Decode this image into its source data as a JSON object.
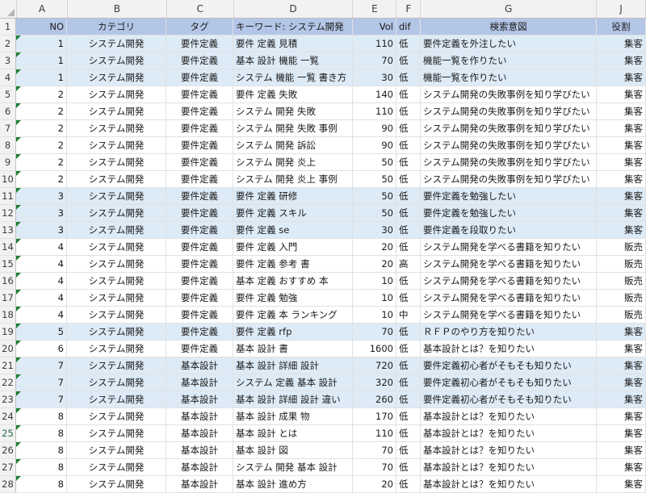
{
  "columns": [
    "A",
    "B",
    "C",
    "D",
    "E",
    "F",
    "G",
    "J"
  ],
  "header": {
    "no": "NO",
    "category": "カテゴリ",
    "tag": "タグ",
    "keyword": "キーワード: システム開発",
    "vol": "Vol",
    "dif": "dif",
    "intent": "検索意図",
    "role": "役割"
  },
  "rows": [
    {
      "rn": "2",
      "no": "1",
      "cat": "システム開発",
      "tag": "要件定義",
      "kw": "要件 定義 見積",
      "vol": "110",
      "dif": "低",
      "intent": "要件定義を外注したい",
      "role": "集客",
      "hl": true
    },
    {
      "rn": "3",
      "no": "1",
      "cat": "システム開発",
      "tag": "要件定義",
      "kw": "基本 設計 機能 一覧",
      "vol": "70",
      "dif": "低",
      "intent": "機能一覧を作りたい",
      "role": "集客",
      "hl": true
    },
    {
      "rn": "4",
      "no": "1",
      "cat": "システム開発",
      "tag": "要件定義",
      "kw": "システム 機能 一覧 書き方",
      "vol": "30",
      "dif": "低",
      "intent": "機能一覧を作りたい",
      "role": "集客",
      "hl": true
    },
    {
      "rn": "5",
      "no": "2",
      "cat": "システム開発",
      "tag": "要件定義",
      "kw": "要件 定義 失敗",
      "vol": "140",
      "dif": "低",
      "intent": "システム開発の失敗事例を知り学びたい",
      "role": "集客",
      "hl": false
    },
    {
      "rn": "6",
      "no": "2",
      "cat": "システム開発",
      "tag": "要件定義",
      "kw": "システム 開発 失敗",
      "vol": "110",
      "dif": "低",
      "intent": "システム開発の失敗事例を知り学びたい",
      "role": "集客",
      "hl": false
    },
    {
      "rn": "7",
      "no": "2",
      "cat": "システム開発",
      "tag": "要件定義",
      "kw": "システム 開発 失敗 事例",
      "vol": "90",
      "dif": "低",
      "intent": "システム開発の失敗事例を知り学びたい",
      "role": "集客",
      "hl": false
    },
    {
      "rn": "8",
      "no": "2",
      "cat": "システム開発",
      "tag": "要件定義",
      "kw": "システム 開発 訴訟",
      "vol": "90",
      "dif": "低",
      "intent": "システム開発の失敗事例を知り学びたい",
      "role": "集客",
      "hl": false
    },
    {
      "rn": "9",
      "no": "2",
      "cat": "システム開発",
      "tag": "要件定義",
      "kw": "システム 開発 炎上",
      "vol": "50",
      "dif": "低",
      "intent": "システム開発の失敗事例を知り学びたい",
      "role": "集客",
      "hl": false
    },
    {
      "rn": "10",
      "no": "2",
      "cat": "システム開発",
      "tag": "要件定義",
      "kw": "システム 開発 炎上 事例",
      "vol": "50",
      "dif": "低",
      "intent": "システム開発の失敗事例を知り学びたい",
      "role": "集客",
      "hl": false
    },
    {
      "rn": "11",
      "no": "3",
      "cat": "システム開発",
      "tag": "要件定義",
      "kw": "要件 定義 研修",
      "vol": "50",
      "dif": "低",
      "intent": "要件定義を勉強したい",
      "role": "集客",
      "hl": true
    },
    {
      "rn": "12",
      "no": "3",
      "cat": "システム開発",
      "tag": "要件定義",
      "kw": "要件 定義 スキル",
      "vol": "50",
      "dif": "低",
      "intent": "要件定義を勉強したい",
      "role": "集客",
      "hl": true
    },
    {
      "rn": "13",
      "no": "3",
      "cat": "システム開発",
      "tag": "要件定義",
      "kw": "要件 定義 se",
      "vol": "30",
      "dif": "低",
      "intent": "要件定義を段取りたい",
      "role": "集客",
      "hl": true
    },
    {
      "rn": "14",
      "no": "4",
      "cat": "システム開発",
      "tag": "要件定義",
      "kw": "要件 定義 入門",
      "vol": "20",
      "dif": "低",
      "intent": "システム開発を学べる書籍を知りたい",
      "role": "販売",
      "hl": false
    },
    {
      "rn": "15",
      "no": "4",
      "cat": "システム開発",
      "tag": "要件定義",
      "kw": "要件 定義 参考 書",
      "vol": "20",
      "dif": "高",
      "intent": "システム開発を学べる書籍を知りたい",
      "role": "販売",
      "hl": false
    },
    {
      "rn": "16",
      "no": "4",
      "cat": "システム開発",
      "tag": "要件定義",
      "kw": "基本 定義 おすすめ 本",
      "vol": "10",
      "dif": "低",
      "intent": "システム開発を学べる書籍を知りたい",
      "role": "販売",
      "hl": false
    },
    {
      "rn": "17",
      "no": "4",
      "cat": "システム開発",
      "tag": "要件定義",
      "kw": "要件 定義 勉強",
      "vol": "10",
      "dif": "低",
      "intent": "システム開発を学べる書籍を知りたい",
      "role": "販売",
      "hl": false
    },
    {
      "rn": "18",
      "no": "4",
      "cat": "システム開発",
      "tag": "要件定義",
      "kw": "要件 定義 本 ランキング",
      "vol": "10",
      "dif": "中",
      "intent": "システム開発を学べる書籍を知りたい",
      "role": "販売",
      "hl": false
    },
    {
      "rn": "19",
      "no": "5",
      "cat": "システム開発",
      "tag": "要件定義",
      "kw": "要件 定義 rfp",
      "vol": "70",
      "dif": "低",
      "intent": "ＲＦＰのやり方を知りたい",
      "role": "集客",
      "hl": true
    },
    {
      "rn": "20",
      "no": "6",
      "cat": "システム開発",
      "tag": "要件定義",
      "kw": "基本 設計 書",
      "vol": "1600",
      "dif": "低",
      "intent": "基本設計とは？を知りたい",
      "role": "集客",
      "hl": false
    },
    {
      "rn": "21",
      "no": "7",
      "cat": "システム開発",
      "tag": "基本設計",
      "kw": "基本 設計 詳細 設計",
      "vol": "720",
      "dif": "低",
      "intent": "要件定義初心者がそもそも知りたい",
      "role": "集客",
      "hl": true
    },
    {
      "rn": "22",
      "no": "7",
      "cat": "システム開発",
      "tag": "基本設計",
      "kw": "システム 定義 基本 設計",
      "vol": "320",
      "dif": "低",
      "intent": "要件定義初心者がそもそも知りたい",
      "role": "集客",
      "hl": true
    },
    {
      "rn": "23",
      "no": "7",
      "cat": "システム開発",
      "tag": "基本設計",
      "kw": "基本 設計 詳細 設計 違い",
      "vol": "260",
      "dif": "低",
      "intent": "要件定義初心者がそもそも知りたい",
      "role": "集客",
      "hl": true
    },
    {
      "rn": "24",
      "no": "8",
      "cat": "システム開発",
      "tag": "基本設計",
      "kw": "基本 設計 成果 物",
      "vol": "170",
      "dif": "低",
      "intent": "基本設計とは？を知りたい",
      "role": "集客",
      "hl": false
    },
    {
      "rn": "25",
      "no": "8",
      "cat": "システム開発",
      "tag": "基本設計",
      "kw": "基本 設計 とは",
      "vol": "110",
      "dif": "低",
      "intent": "基本設計とは？を知りたい",
      "role": "集客",
      "hl": false,
      "sel": true
    },
    {
      "rn": "26",
      "no": "8",
      "cat": "システム開発",
      "tag": "基本設計",
      "kw": "基本 設計 図",
      "vol": "70",
      "dif": "低",
      "intent": "基本設計とは？を知りたい",
      "role": "集客",
      "hl": false
    },
    {
      "rn": "27",
      "no": "8",
      "cat": "システム開発",
      "tag": "基本設計",
      "kw": "システム 開発 基本 設計",
      "vol": "70",
      "dif": "低",
      "intent": "基本設計とは？を知りたい",
      "role": "集客",
      "hl": false
    },
    {
      "rn": "28",
      "no": "8",
      "cat": "システム開発",
      "tag": "基本設計",
      "kw": "基本 設計 進め方",
      "vol": "20",
      "dif": "低",
      "intent": "基本設計とは？を知りたい",
      "role": "集客",
      "hl": false
    }
  ]
}
